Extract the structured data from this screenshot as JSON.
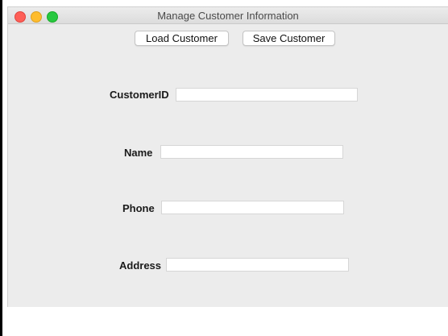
{
  "window": {
    "title": "Manage Customer Information"
  },
  "toolbar": {
    "load_label": "Load Customer",
    "save_label": "Save Customer"
  },
  "form": {
    "customer_id_label": "CustomerID",
    "customer_id_value": "",
    "name_label": "Name",
    "name_value": "",
    "phone_label": "Phone",
    "phone_value": "",
    "address_label": "Address",
    "address_value": ""
  },
  "colors": {
    "close": "#fe5f57",
    "minimize": "#febc2e",
    "maximize": "#28c840",
    "window_bg": "#ececec"
  }
}
